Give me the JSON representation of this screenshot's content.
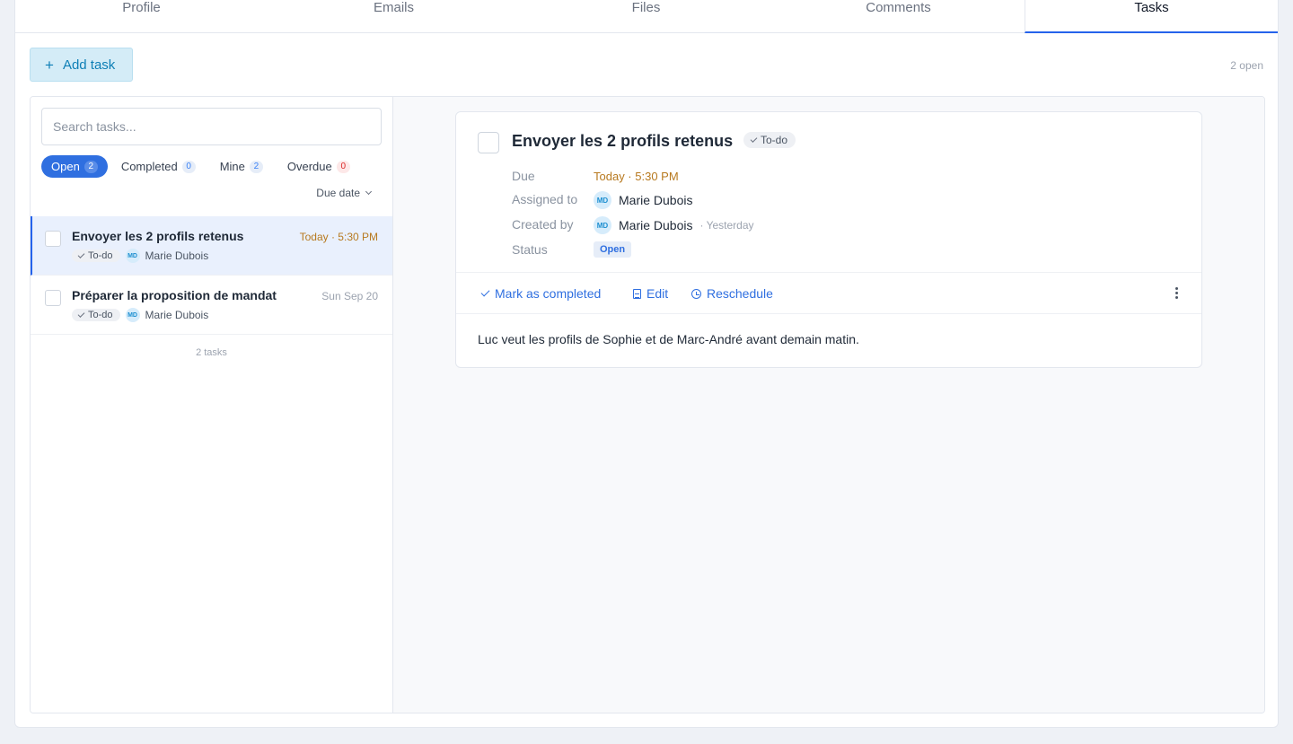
{
  "tabs": [
    {
      "label": "Profile"
    },
    {
      "label": "Emails"
    },
    {
      "label": "Files"
    },
    {
      "label": "Comments"
    },
    {
      "label": "Tasks",
      "active": true
    }
  ],
  "toolbar": {
    "add_task_label": "Add task",
    "open_count": "2 open"
  },
  "search": {
    "placeholder": "Search tasks..."
  },
  "filters": [
    {
      "label": "Open",
      "count": "2",
      "active": true
    },
    {
      "label": "Completed",
      "count": "0"
    },
    {
      "label": "Mine",
      "count": "2"
    },
    {
      "label": "Overdue",
      "count": "0"
    }
  ],
  "sort": {
    "label": "Due date"
  },
  "tasks": [
    {
      "title": "Envoyer les 2 profils retenus",
      "date": "Today · 5:30 PM",
      "type": "To-do",
      "assignee_initials": "MD",
      "assignee": "Marie Dubois"
    },
    {
      "title": "Préparer la proposition de mandat",
      "date": "Sun Sep 20",
      "type": "To-do",
      "assignee_initials": "MD",
      "assignee": "Marie Dubois"
    }
  ],
  "list_footer": "2 tasks",
  "detail": {
    "title": "Envoyer les 2 profils retenus",
    "type": "To-do",
    "fields": {
      "due_label": "Due",
      "due_value": "Today · 5:30 PM",
      "assigned_label": "Assigned to",
      "assigned_initials": "MD",
      "assigned_value": "Marie Dubois",
      "created_label": "Created by",
      "created_initials": "MD",
      "created_value": "Marie Dubois",
      "created_when": "· Yesterday",
      "status_label": "Status",
      "status_value": "Open"
    },
    "actions": {
      "complete": "Mark as completed",
      "edit": "Edit",
      "reschedule": "Reschedule"
    },
    "description": "Luc veut les profils de Sophie et de Marc-André avant demain matin."
  },
  "colors": {
    "accent": "#2f6fe0",
    "due_today": "#b7791f",
    "add_button_bg": "#d4ecf7"
  }
}
